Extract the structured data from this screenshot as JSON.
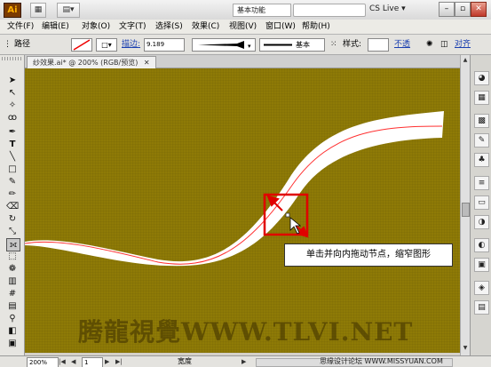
{
  "app": {
    "logo": "Ai"
  },
  "titlebar": {
    "workspace": "基本功能",
    "cslive": "CS Live"
  },
  "menu": [
    "文件(F)",
    "编辑(E)",
    "对象(O)",
    "文字(T)",
    "选择(S)",
    "效果(C)",
    "视图(V)",
    "窗口(W)",
    "帮助(H)"
  ],
  "control": {
    "selection_type": "路径",
    "stroke_label": "描边:",
    "stroke_value": "9.189",
    "profile_label": "基本",
    "style_label": "样式:",
    "opacity_label": "不透",
    "align_label": "对齐"
  },
  "document": {
    "tab": "纱效果.ai* @ 200% (RGB/预览)"
  },
  "canvas": {
    "tooltip": "单击并向内拖动节点，缩窄图形",
    "watermark": "腾龍視覺WWW.TLVI.NET",
    "background": "#8e7a06",
    "accent": "#ff0000"
  },
  "status": {
    "zoom": "200%",
    "page": "1",
    "tool_name": "宽度",
    "credit": "思缘设计论坛 WWW.MISSYUAN.COM"
  },
  "icons": [
    "selection-tool",
    "direct-selection-tool",
    "magic-wand",
    "lasso",
    "pen",
    "type",
    "line",
    "rectangle",
    "paintbrush",
    "pencil",
    "eraser",
    "rotate",
    "scale",
    "width-tool",
    "free-transform",
    "symbol-sprayer",
    "graph",
    "mesh",
    "gradient",
    "eyedropper",
    "blend",
    "slice",
    "hand",
    "zoom"
  ]
}
